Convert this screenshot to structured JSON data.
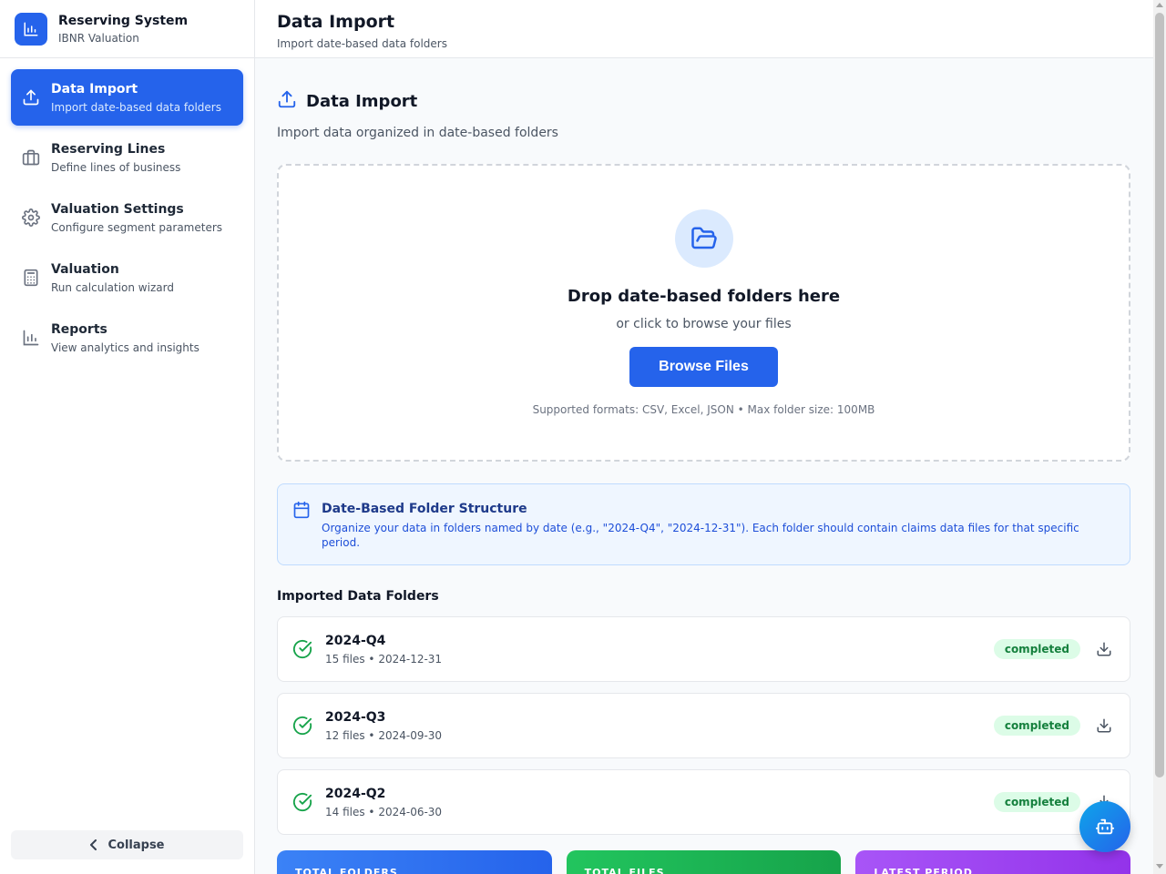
{
  "brand": {
    "title": "Reserving System",
    "subtitle": "IBNR Valuation",
    "icon": "bar-chart-icon"
  },
  "sidebar": {
    "items": [
      {
        "label": "Data Import",
        "desc": "Import date-based data folders",
        "icon": "upload-icon",
        "active": true
      },
      {
        "label": "Reserving Lines",
        "desc": "Define lines of business",
        "icon": "briefcase-icon",
        "active": false
      },
      {
        "label": "Valuation Settings",
        "desc": "Configure segment parameters",
        "icon": "gear-icon",
        "active": false
      },
      {
        "label": "Valuation",
        "desc": "Run calculation wizard",
        "icon": "calculator-icon",
        "active": false
      },
      {
        "label": "Reports",
        "desc": "View analytics and insights",
        "icon": "bar-chart-icon",
        "active": false
      }
    ],
    "collapse_label": "Collapse"
  },
  "topbar": {
    "title": "Data Import",
    "subtitle": "Import date-based data folders"
  },
  "section": {
    "title": "Data Import",
    "subtitle": "Import data organized in date-based folders"
  },
  "dropzone": {
    "title": "Drop date-based folders here",
    "subtitle": "or click to browse your files",
    "button_label": "Browse Files",
    "note": "Supported formats: CSV, Excel, JSON • Max folder size: 100MB"
  },
  "info": {
    "title": "Date-Based Folder Structure",
    "desc": "Organize your data in folders named by date (e.g., \"2024-Q4\", \"2024-12-31\"). Each folder should contain claims data files for that specific period."
  },
  "folders": {
    "title": "Imported Data Folders",
    "items": [
      {
        "name": "2024-Q4",
        "meta": "15 files • 2024-12-31",
        "status": "completed"
      },
      {
        "name": "2024-Q3",
        "meta": "12 files • 2024-09-30",
        "status": "completed"
      },
      {
        "name": "2024-Q2",
        "meta": "14 files • 2024-06-30",
        "status": "completed"
      }
    ]
  },
  "stats": [
    {
      "label": "TOTAL FOLDERS"
    },
    {
      "label": "TOTAL FILES"
    },
    {
      "label": "LATEST PERIOD"
    }
  ],
  "colors": {
    "primary": "#2563eb",
    "success": "#16a34a",
    "success_bg": "#dcfce7",
    "info_bg": "#eff6ff"
  }
}
